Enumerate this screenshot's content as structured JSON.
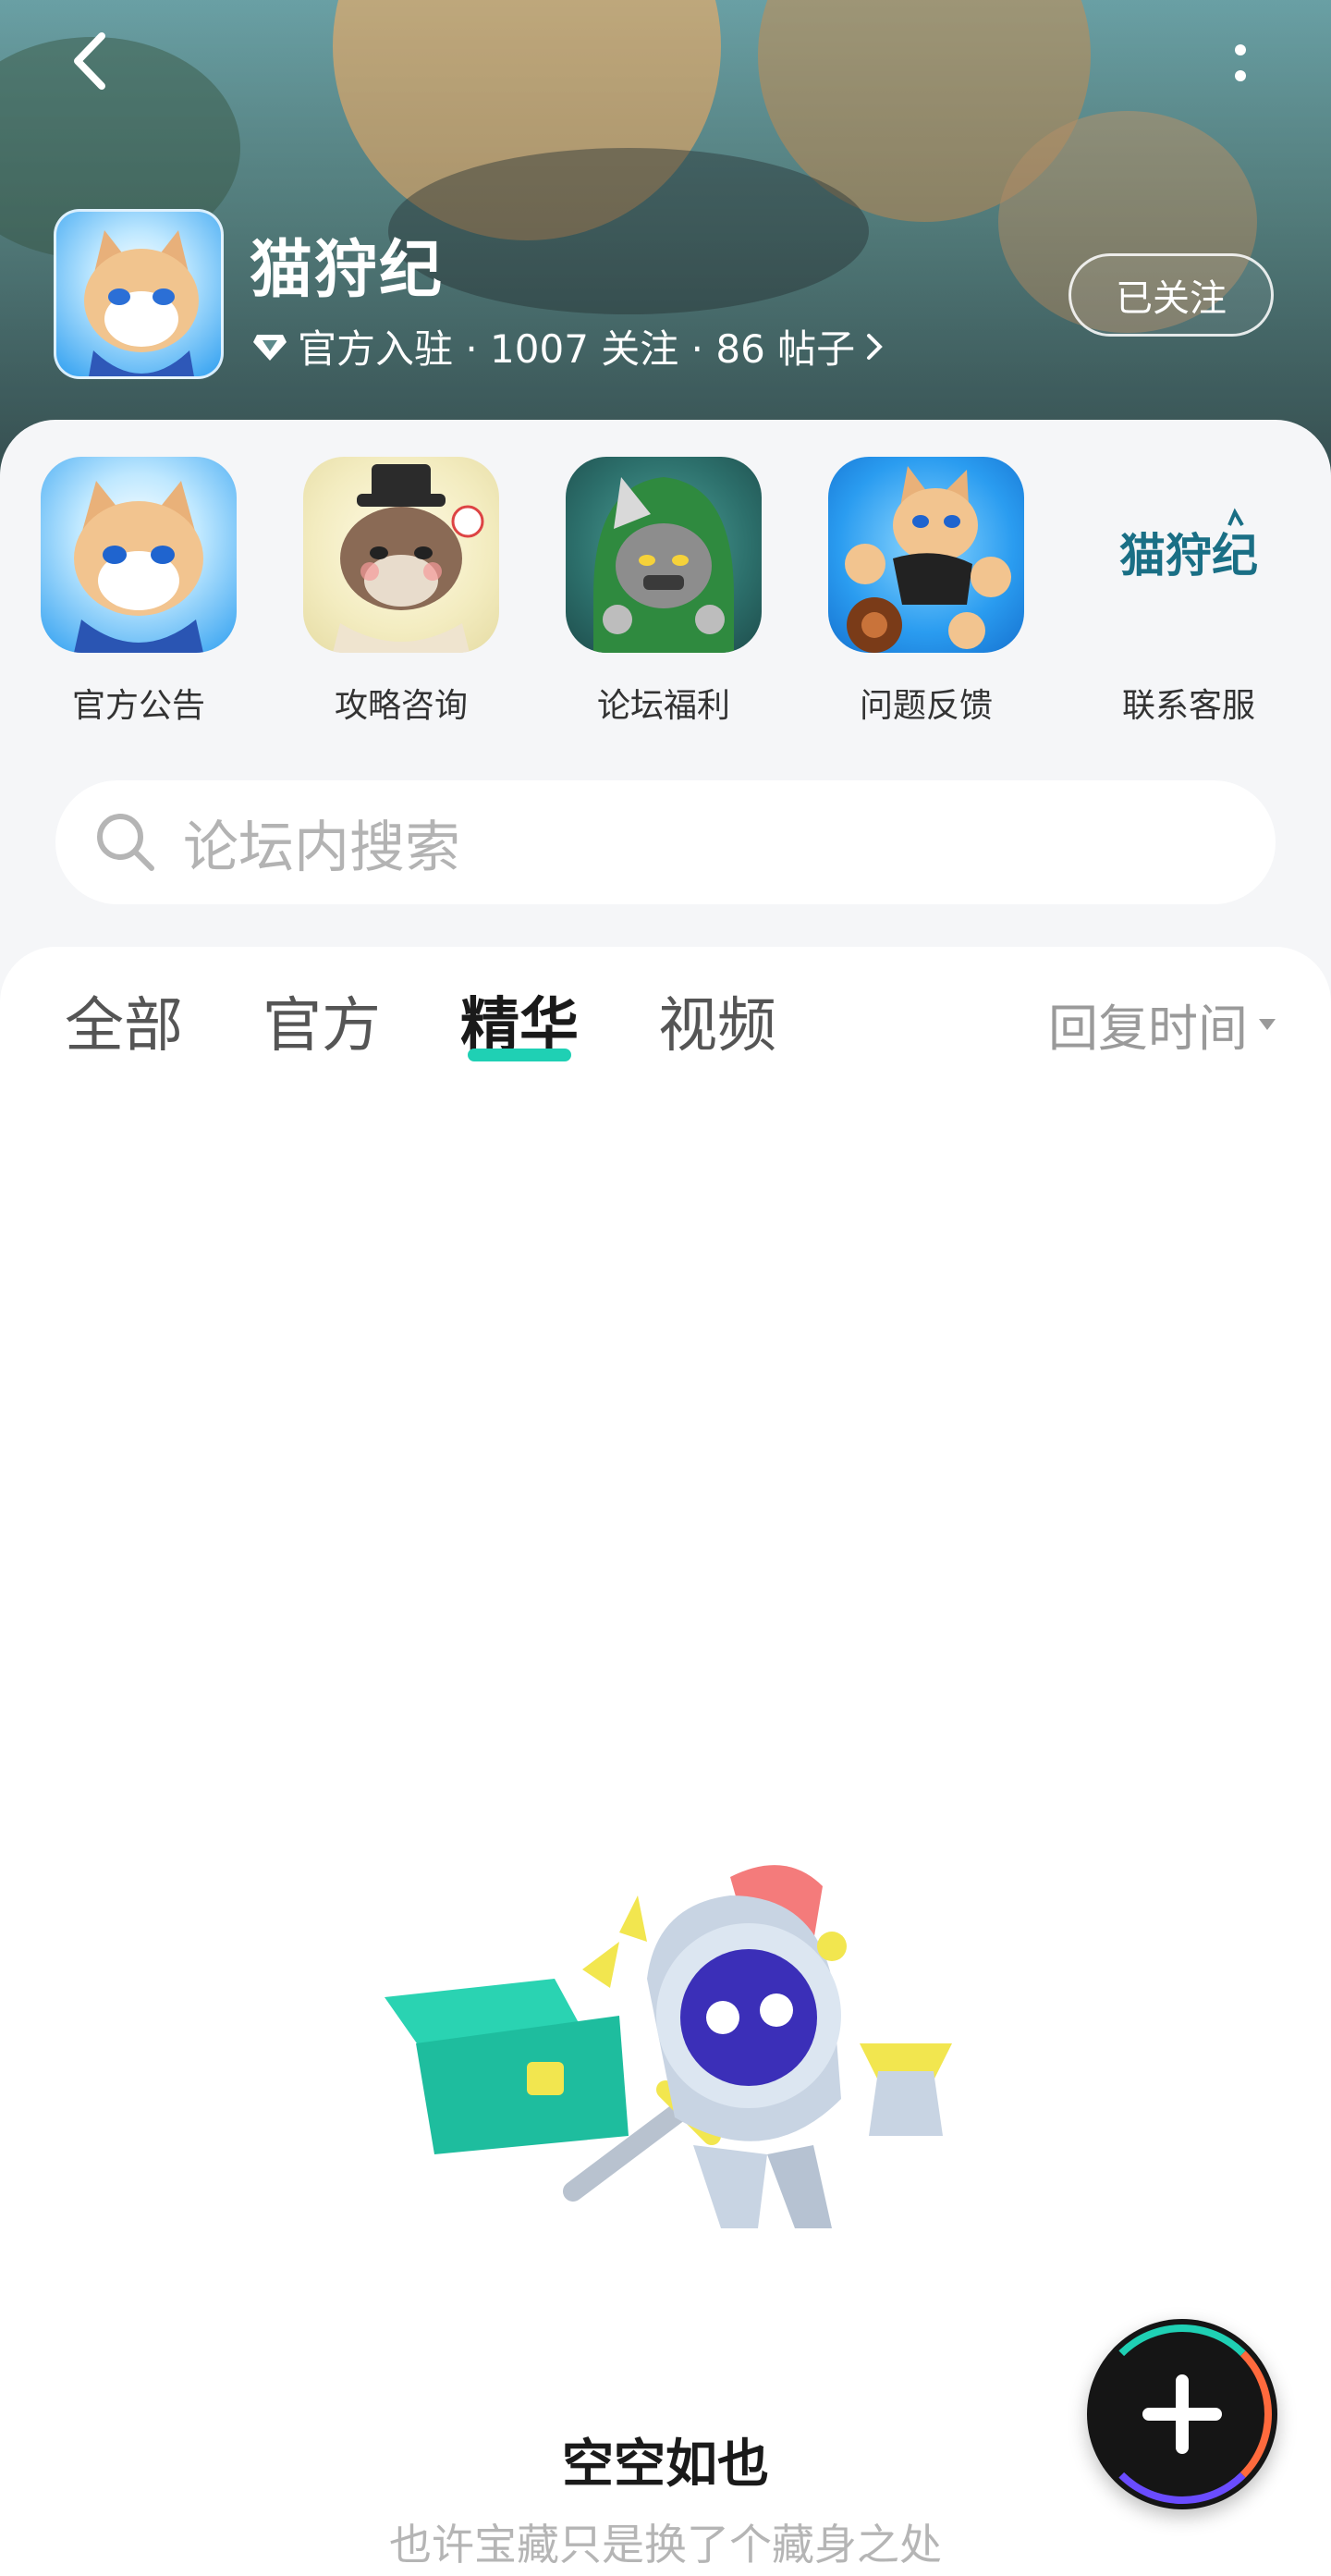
{
  "header": {
    "game_name": "猫狩纪",
    "meta_text": "官方入驻 · 1007 关注 · 86 帖子",
    "follow_label": "已关注"
  },
  "shortcuts": [
    {
      "label": "官方公告",
      "icon": "cat-scholar-avatar"
    },
    {
      "label": "攻略咨询",
      "icon": "cat-official-avatar"
    },
    {
      "label": "论坛福利",
      "icon": "hooded-cat-avatar"
    },
    {
      "label": "问题反馈",
      "icon": "running-cat-avatar"
    },
    {
      "label": "联系客服",
      "icon": "game-logo",
      "logo_text": "猫狩纪"
    }
  ],
  "search": {
    "placeholder": "论坛内搜索"
  },
  "tabs": [
    {
      "label": "全部",
      "active": false
    },
    {
      "label": "官方",
      "active": false
    },
    {
      "label": "精华",
      "active": true
    },
    {
      "label": "视频",
      "active": false
    }
  ],
  "sort": {
    "label": "回复时间"
  },
  "empty_state": {
    "title": "空空如也",
    "subtitle": "也许宝藏只是换了个藏身之处"
  },
  "colors": {
    "accent": "#1fd0b4",
    "fab_bg": "#151515"
  }
}
